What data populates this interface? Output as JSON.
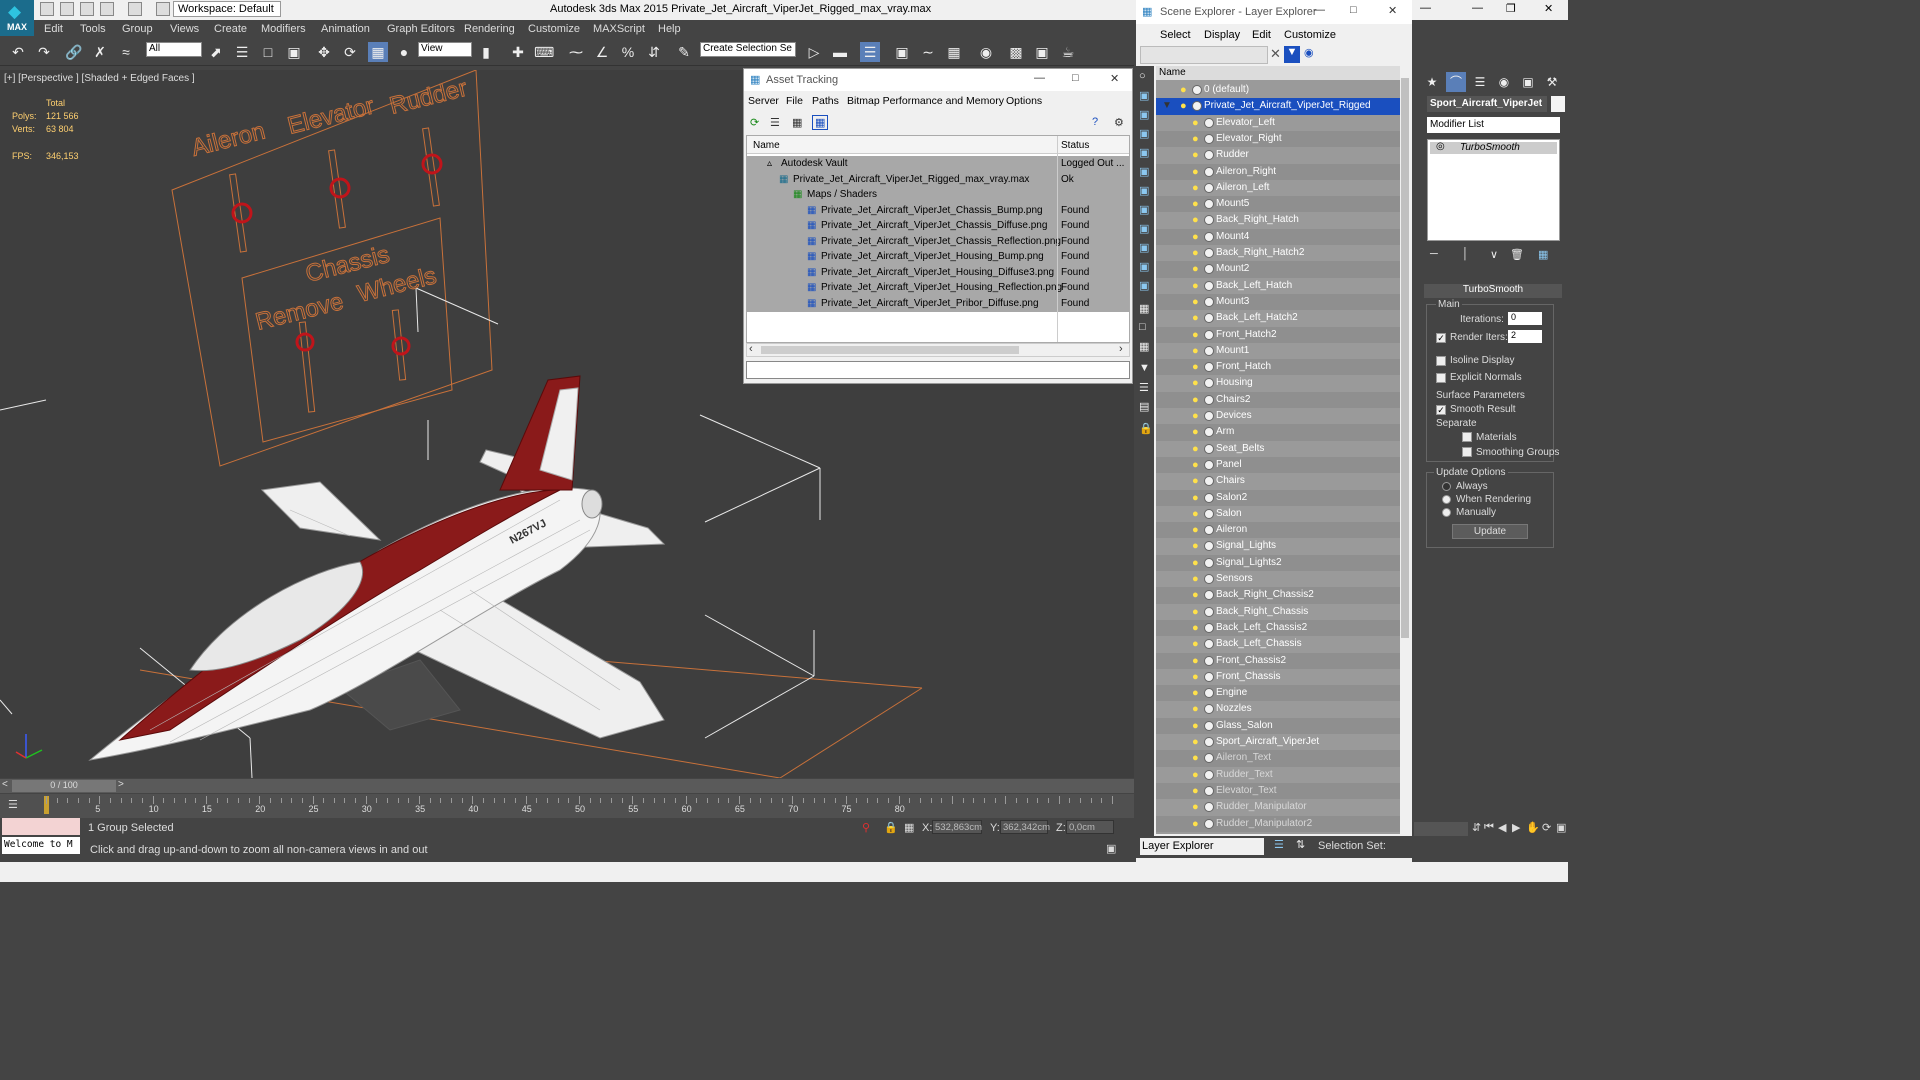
{
  "app": {
    "title": "Autodesk 3ds Max  2015    Private_Jet_Aircraft_ViperJet_Rigged_max_vray.max",
    "logo": "MAX",
    "workspace": "Workspace: Default"
  },
  "menubar": [
    "Edit",
    "Tools",
    "Group",
    "Views",
    "Create",
    "Modifiers",
    "Animation",
    "Graph Editors",
    "Rendering",
    "Customize",
    "MAXScript",
    "Help"
  ],
  "toolbar": {
    "filter": "All",
    "ref_coord": "View",
    "selection_set": "Create Selection Se"
  },
  "viewport": {
    "label": "[+] [Perspective ] [Shaded + Edged Faces ]",
    "stats": {
      "total_label": "Total",
      "polys_label": "Polys:",
      "polys": "121 566",
      "verts_label": "Verts:",
      "verts": "63 804",
      "fps_label": "FPS:",
      "fps": "346,153"
    },
    "controls": {
      "aileron": "Aileron",
      "elevator": "Elevator",
      "rudder": "Rudder",
      "chassis": "Chassis",
      "remove": "Remove",
      "wheels": "Wheels"
    },
    "tail_reg": "N267VJ"
  },
  "asset_tracking": {
    "title": "Asset Tracking",
    "menu": [
      "Server",
      "File",
      "Paths",
      "Bitmap Performance and Memory",
      "Options"
    ],
    "columns": {
      "name": "Name",
      "status": "Status"
    },
    "rows": [
      {
        "name": "Autodesk Vault",
        "status": "Logged Out ..."
      },
      {
        "name": "Private_Jet_Aircraft_ViperJet_Rigged_max_vray.max",
        "status": "Ok"
      },
      {
        "name": "Maps / Shaders",
        "status": ""
      },
      {
        "name": "Private_Jet_Aircraft_ViperJet_Chassis_Bump.png",
        "status": "Found"
      },
      {
        "name": "Private_Jet_Aircraft_ViperJet_Chassis_Diffuse.png",
        "status": "Found"
      },
      {
        "name": "Private_Jet_Aircraft_ViperJet_Chassis_Reflection.png",
        "status": "Found"
      },
      {
        "name": "Private_Jet_Aircraft_ViperJet_Housing_Bump.png",
        "status": "Found"
      },
      {
        "name": "Private_Jet_Aircraft_ViperJet_Housing_Diffuse3.png",
        "status": "Found"
      },
      {
        "name": "Private_Jet_Aircraft_ViperJet_Housing_Reflection.png",
        "status": "Found"
      },
      {
        "name": "Private_Jet_Aircraft_ViperJet_Pribor_Diffuse.png",
        "status": "Found"
      }
    ]
  },
  "scene_explorer": {
    "title": "Scene Explorer - Layer Explorer",
    "menu": [
      "Select",
      "Display",
      "Edit",
      "Customize"
    ],
    "column": "Name",
    "layers": [
      "0 (default)",
      "Private_Jet_Aircraft_ViperJet_Rigged",
      "Elevator_Left",
      "Elevator_Right",
      "Rudder",
      "Aileron_Right",
      "Aileron_Left",
      "Mount5",
      "Back_Right_Hatch",
      "Mount4",
      "Back_Right_Hatch2",
      "Mount2",
      "Back_Left_Hatch",
      "Mount3",
      "Back_Left_Hatch2",
      "Front_Hatch2",
      "Mount1",
      "Front_Hatch",
      "Housing",
      "Chairs2",
      "Devices",
      "Arm",
      "Seat_Belts",
      "Panel",
      "Chairs",
      "Salon2",
      "Salon",
      "Aileron",
      "Signal_Lights",
      "Signal_Lights2",
      "Sensors",
      "Back_Right_Chassis2",
      "Back_Right_Chassis",
      "Back_Left_Chassis2",
      "Back_Left_Chassis",
      "Front_Chassis2",
      "Front_Chassis",
      "Engine",
      "Nozzles",
      "Glass_Salon",
      "Sport_Aircraft_ViperJet",
      "Aileron_Text",
      "Rudder_Text",
      "Elevator_Text",
      "Rudder_Manipulator",
      "Rudder_Manipulator2"
    ],
    "footer_explorer": "Layer Explorer",
    "footer_selset": "Selection Set:"
  },
  "command_panel": {
    "object_name": "Sport_Aircraft_ViperJet",
    "modifier_list": "Modifier List",
    "stack_item": "TurboSmooth",
    "rollout": "TurboSmooth",
    "main": "Main",
    "iterations_label": "Iterations:",
    "iterations": "0",
    "render_iters_label": "Render Iters:",
    "render_iters": "2",
    "isoline": "Isoline Display",
    "explicit_normals": "Explicit Normals",
    "surface_params": "Surface Parameters",
    "smooth_result": "Smooth Result",
    "separate": "Separate",
    "materials": "Materials",
    "smoothing_groups": "Smoothing Groups",
    "update_options": "Update Options",
    "always": "Always",
    "when_rendering": "When Rendering",
    "manually": "Manually",
    "update": "Update"
  },
  "timeline": {
    "frame": "0 / 100",
    "ticks": [
      "5",
      "10",
      "15",
      "20",
      "25",
      "30",
      "35",
      "40",
      "45",
      "50",
      "55",
      "60",
      "65",
      "70",
      "75",
      "80"
    ]
  },
  "status": {
    "welcome": "Welcome to M",
    "selected": "1 Group Selected",
    "prompt": "Click and drag up-and-down to zoom all non-camera views in and out",
    "x_label": "X:",
    "x": "532,863cm",
    "y_label": "Y:",
    "y": "362,342cm",
    "z_label": "Z:",
    "z": "0,0cm"
  },
  "colors": {
    "accent_selected": "#1a4fbf",
    "wire_orange": "#c8713a",
    "aircraft_red": "#8a1a1a"
  }
}
